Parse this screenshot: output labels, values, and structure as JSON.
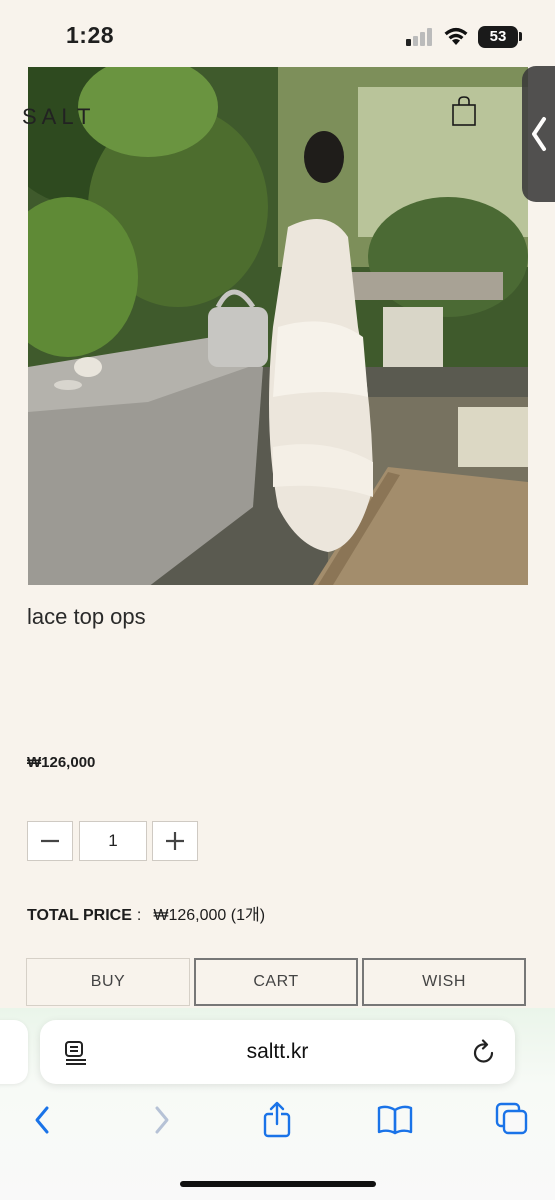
{
  "status_bar": {
    "time": "1:28",
    "battery": "53",
    "signal-icon": "cellular-signal-icon",
    "wifi-icon": "wifi-icon"
  },
  "header": {
    "logo": "SALT",
    "cart_icon": "shopping-bag-icon",
    "side_tab_icon": "chevron-left-icon"
  },
  "product": {
    "name": "lace top ops",
    "price": "₩126,000",
    "quantity": "1",
    "image": "photo of woman in white lace dress beside table in garden"
  },
  "total": {
    "label": "TOTAL PRICE",
    "separator": ":",
    "value": "₩126,000 (1개)"
  },
  "actions": {
    "buy": "BUY",
    "cart": "CART",
    "wish": "WISH"
  },
  "browser": {
    "url": "saltt.kr",
    "accent_color": "#1a73e8"
  }
}
